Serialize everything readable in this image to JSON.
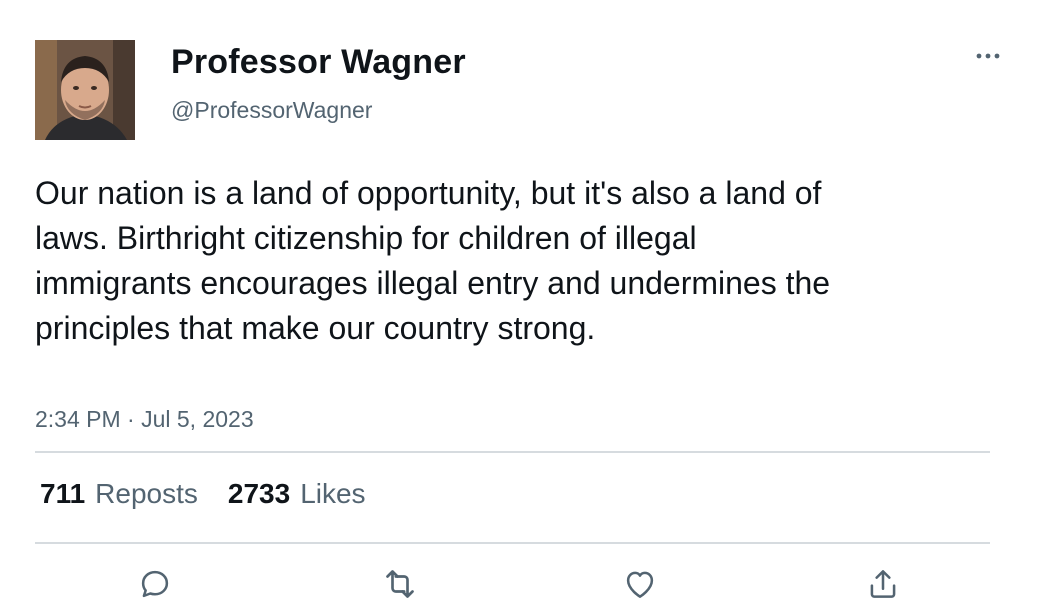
{
  "tweet": {
    "author_name": "Professor Wagner",
    "author_handle": "@ProfessorWagner",
    "text": "Our nation is a land of opportunity, but it's also a land of laws. Birthright citizenship for children of illegal immigrants encourages illegal entry and undermines the principles that make our country strong.",
    "timestamp": "2:34 PM · Jul 5, 2023",
    "reposts_count": "711",
    "reposts_label": "Reposts",
    "likes_count": "2733",
    "likes_label": "Likes"
  },
  "icons": {
    "more": "more-horizontal-icon",
    "reply": "reply-icon",
    "repost": "repost-icon",
    "like": "like-icon",
    "share": "share-icon"
  },
  "colors": {
    "text_primary": "#0f1419",
    "text_secondary": "#536471",
    "divider": "#d6dbdf"
  }
}
